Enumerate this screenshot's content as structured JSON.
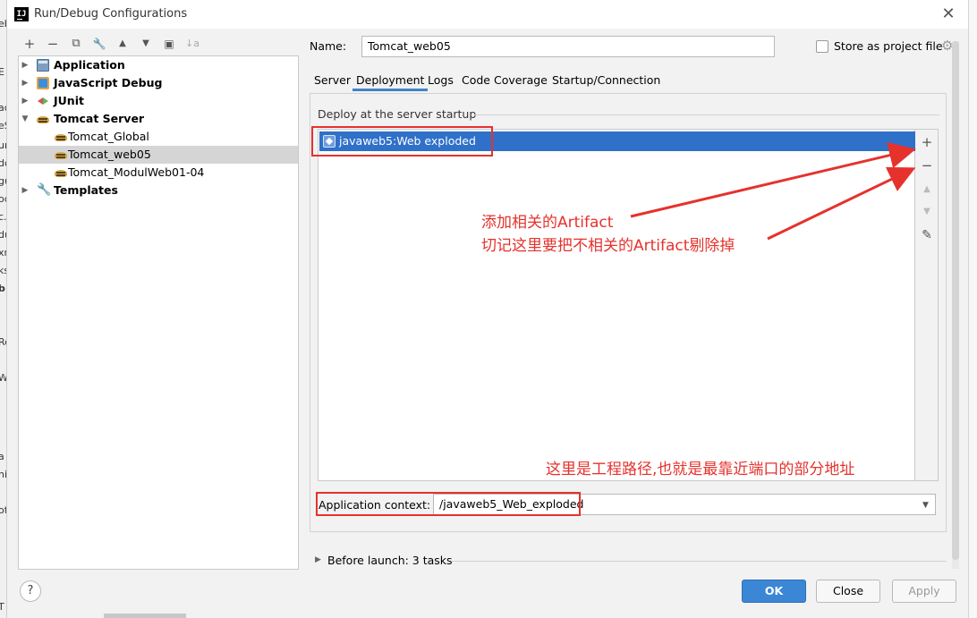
{
  "window": {
    "title": "Run/Debug Configurations",
    "app_icon_text": "IJ"
  },
  "background_fragments": [
    "eb",
    "E",
    "ac",
    "eS",
    "ur",
    "do",
    "gu",
    "oc",
    "c.x",
    "du",
    "xn",
    "ks",
    "b",
    "Re",
    "W",
    "a",
    "ni",
    "ot",
    "T"
  ],
  "toolbar": {
    "add": "+",
    "remove": "−",
    "copy": "⧉",
    "edit_defaults": "🔧",
    "move_up": "▲",
    "move_down": "▼",
    "new_folder": "▣",
    "sort": "↓a"
  },
  "tree": {
    "items": [
      {
        "label": "Application",
        "bold": true,
        "expandable": true,
        "expanded": false,
        "icon": "application-icon"
      },
      {
        "label": "JavaScript Debug",
        "bold": true,
        "expandable": true,
        "expanded": false,
        "icon": "javascript-debug-icon"
      },
      {
        "label": "JUnit",
        "bold": true,
        "expandable": true,
        "expanded": false,
        "icon": "junit-icon"
      },
      {
        "label": "Tomcat Server",
        "bold": true,
        "expandable": true,
        "expanded": true,
        "icon": "tomcat-icon"
      },
      {
        "label": "Tomcat_Global",
        "bold": false,
        "child": true,
        "icon": "tomcat-icon"
      },
      {
        "label": "Tomcat_web05",
        "bold": false,
        "child": true,
        "selected": true,
        "icon": "tomcat-icon"
      },
      {
        "label": "Tomcat_ModulWeb01-04",
        "bold": false,
        "child": true,
        "icon": "tomcat-icon"
      },
      {
        "label": "Templates",
        "bold": true,
        "expandable": true,
        "expanded": false,
        "icon": "wrench-icon"
      }
    ]
  },
  "name_row": {
    "label": "Name:",
    "value": "Tomcat_web05",
    "store_label": "Store as project file",
    "store_checked": false
  },
  "tabs": [
    {
      "label": "Server",
      "active": false
    },
    {
      "label": "Deployment",
      "active": true
    },
    {
      "label": "Logs",
      "active": false
    },
    {
      "label": "Code Coverage",
      "active": false
    },
    {
      "label": "Startup/Connection",
      "active": false
    }
  ],
  "deployment": {
    "section_title": "Deploy at the server startup",
    "items": [
      {
        "label": "javaweb5:Web exploded",
        "selected": true
      }
    ],
    "side_tools": {
      "add": "+",
      "remove": "−",
      "up": "▲",
      "down": "▼",
      "edit": "✎"
    },
    "app_context_label": "Application context:",
    "app_context_value": "/javaweb5_Web_exploded"
  },
  "before_launch": {
    "label": "Before launch: 3 tasks"
  },
  "buttons": {
    "help": "?",
    "ok": "OK",
    "close": "Close",
    "apply": "Apply"
  },
  "annotations": {
    "add_artifact": "添加相关的Artifact",
    "remove_artifact": "切记这里要把不相关的Artifact剔除掉",
    "context_path": "这里是工程路径,也就是最靠近端口的部分地址",
    "color": "#e5322d"
  },
  "colors": {
    "selection": "#2f70c8",
    "ok_button": "#3b87d6",
    "tab_underline": "#4083c9"
  }
}
